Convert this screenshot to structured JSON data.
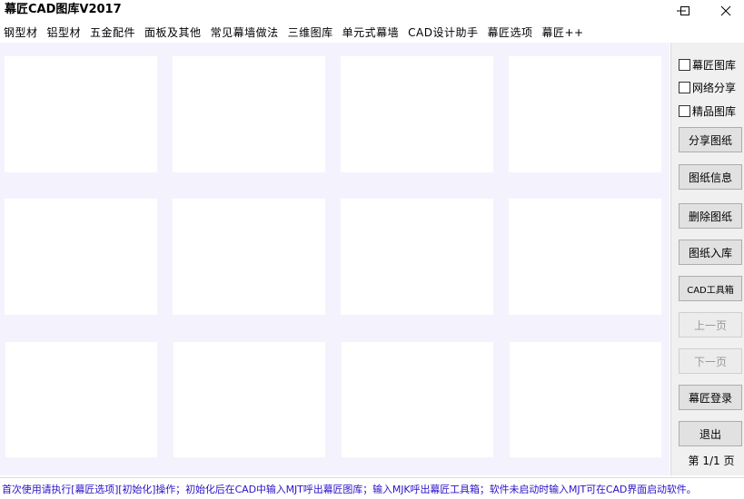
{
  "window": {
    "title": "幕匠CAD图库V2017",
    "minimize_icon": "minimize-icon",
    "maximize_icon": "maximize-icon",
    "close_icon": "close-icon"
  },
  "menu": {
    "items": [
      "钢型材",
      "铝型材",
      "五金配件",
      "面板及其他",
      "常见幕墙做法",
      "三维图库",
      "单元式幕墙",
      "CAD设计助手",
      "幕匠选项",
      "幕匠++"
    ]
  },
  "gallery": {
    "background": "#f4f3fd",
    "thumbnail_count": 12
  },
  "sidebar": {
    "checkboxes": [
      {
        "label": "幕匠图库",
        "checked": false
      },
      {
        "label": "网络分享",
        "checked": false
      },
      {
        "label": "精品图库",
        "checked": false
      }
    ],
    "buttons": {
      "share": "分享图纸",
      "info": "图纸信息",
      "delete": "删除图纸",
      "import": "图纸入库",
      "cad_tools": "CAD工具箱",
      "prev": "上一页",
      "next": "下一页",
      "login": "幕匠登录",
      "exit": "退出"
    },
    "page_info": "第 1/1 页"
  },
  "status": {
    "text": "首次使用请执行[幕匠选项][初始化]操作；初始化后在CAD中输入MJT呼出幕匠图库；输入MJK呼出幕匠工具箱；软件未启动时输入MJT可在CAD界面启动软件。",
    "color": "#2a12c7"
  }
}
